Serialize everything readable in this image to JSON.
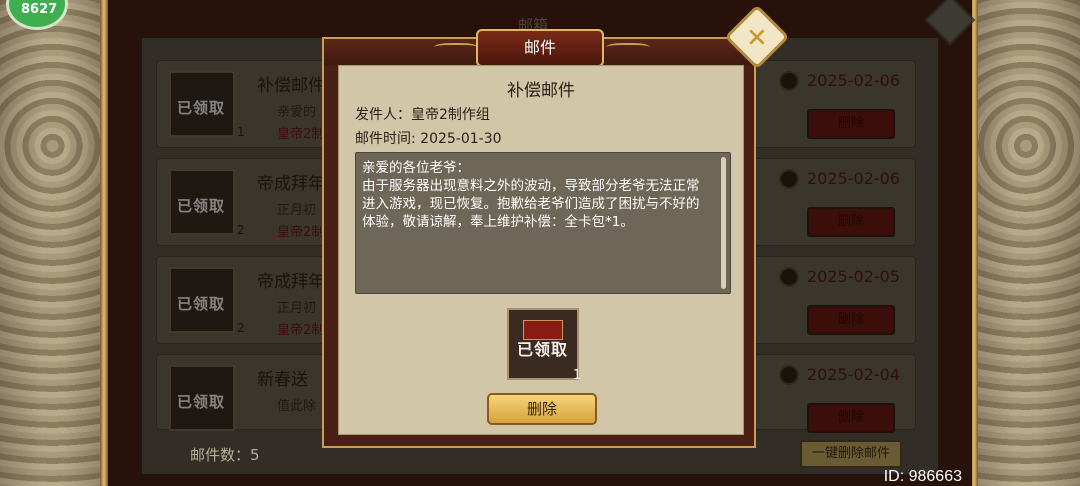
{
  "hud": {
    "avatar_level": "8627"
  },
  "background": {
    "window_title": "邮箱",
    "rows": [
      {
        "title": "补偿邮件",
        "line1": "亲爱的",
        "line2": "皇帝2制",
        "count": "1",
        "date": "2025-02-06",
        "delete": "删除",
        "stamp": "已领取"
      },
      {
        "title": "帝成拜年",
        "line1": "正月初",
        "line2": "皇帝2制",
        "count": "2",
        "date": "2025-02-06",
        "delete": "删除",
        "stamp": "已领取"
      },
      {
        "title": "帝成拜年",
        "line1": "正月初",
        "line2": "皇帝2制",
        "count": "2",
        "date": "2025-02-05",
        "delete": "删除",
        "stamp": "已领取"
      },
      {
        "title": "新春送",
        "line1": "值此除",
        "line2": "",
        "count": "",
        "date": "2025-02-04",
        "delete": "删除",
        "stamp": "已领取"
      }
    ],
    "mail_count": "邮件数：5",
    "delete_all": "一键删除邮件"
  },
  "player_id": "ID: 986663",
  "modal": {
    "header_title": "邮件",
    "subject": "补偿邮件",
    "sender": "发件人：皇帝2制作组",
    "time": "邮件时间: 2025-01-30",
    "body": "亲爱的各位老爷：\n由于服务器出现意料之外的波动，导致部分老爷无法正常进入游戏，现已恢复。抱歉给老爷们造成了困扰与不好的体验，敬请谅解，奉上维护补偿：全卡包*1。",
    "attachment_stamp": "已领取",
    "attachment_count": "1",
    "delete_button": "删除"
  }
}
